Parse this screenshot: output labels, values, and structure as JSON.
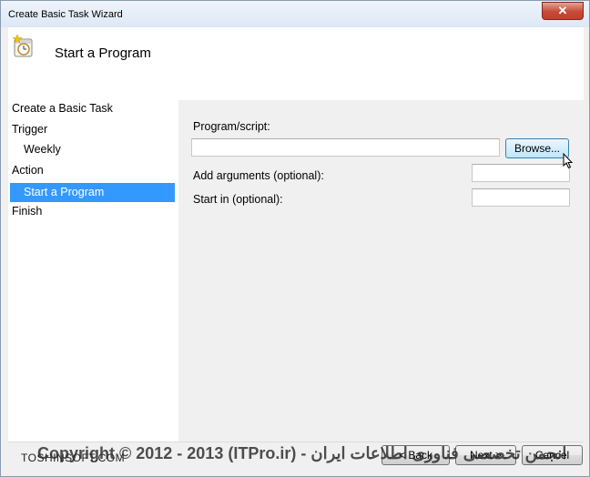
{
  "window": {
    "title": "Create Basic Task Wizard",
    "close_label": "✕"
  },
  "header": {
    "title": "Start a Program",
    "icon": "task-clock-icon"
  },
  "nav": {
    "items": [
      {
        "label": "Create a Basic Task"
      },
      {
        "label": "Trigger"
      },
      {
        "label": "Weekly"
      },
      {
        "label": "Action"
      },
      {
        "label": "Start a Program"
      },
      {
        "label": "Finish"
      }
    ]
  },
  "form": {
    "program_label": "Program/script:",
    "program_value": "",
    "browse_label": "Browse...",
    "arguments_label": "Add arguments (optional):",
    "arguments_value": "",
    "startin_label": "Start in (optional):",
    "startin_value": ""
  },
  "footer": {
    "back_label": "< Back",
    "next_label": "Next >",
    "cancel_label": "Cancel",
    "brand": "TOSHINSOFT.COM",
    "watermark": "Copyright © 2012 - 2013 (ITPro.ir) - انجمن تخصصی فناوری اطلاعات ایران"
  }
}
